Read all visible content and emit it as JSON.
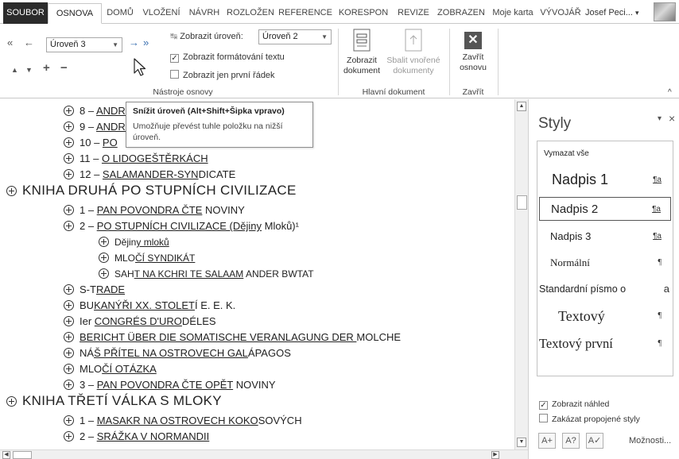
{
  "tabs": [
    {
      "label": "SOUBOR",
      "state": "file"
    },
    {
      "label": "OSNOVA",
      "state": "active"
    },
    {
      "label": "DOMŮ",
      "state": ""
    },
    {
      "label": "VLOŽENÍ",
      "state": ""
    },
    {
      "label": "NÁVRH",
      "state": ""
    },
    {
      "label": "ROZLOŽEN",
      "state": ""
    },
    {
      "label": "REFERENCE",
      "state": ""
    },
    {
      "label": "KORESPON",
      "state": ""
    },
    {
      "label": "REVIZE",
      "state": ""
    },
    {
      "label": "ZOBRAZEN",
      "state": ""
    },
    {
      "label": "Moje karta",
      "state": ""
    },
    {
      "label": "VÝVOJÁŘ",
      "state": ""
    }
  ],
  "user": {
    "name": "Josef Peci...",
    "caret": "▾"
  },
  "ribbon": {
    "outline_tools": {
      "level_dropdown_value": "Úroveň 3",
      "show_level_label": "Zobrazit úroveň:",
      "show_level_value": "Úroveň 2",
      "show_formatting_label": "Zobrazit formátování textu",
      "show_formatting_checked": true,
      "first_line_label": "Zobrazit jen první řádek",
      "first_line_checked": false,
      "group_label": "Nástroje osnovy",
      "promote_to_top_glyph": "«",
      "promote_glyph": "←",
      "demote_glyph": "→",
      "demote_to_body_glyph": "»",
      "move_up_glyph": "▲",
      "move_down_glyph": "▼",
      "expand_glyph": "+",
      "collapse_glyph": "−"
    },
    "master_document": {
      "show_document_label_1": "Zobrazit",
      "show_document_label_2": "dokument",
      "collapse_subdocs_label_1": "Sbalit vnořené",
      "collapse_subdocs_label_2": "dokumenty",
      "group_label": "Hlavní dokument"
    },
    "close": {
      "button_label_1": "Zavřít",
      "button_label_2": "osnovu",
      "group_label": "Zavřít"
    },
    "collapse_ribbon_glyph": "^"
  },
  "tooltip": {
    "title": "Snížit úroveň (Alt+Shift+Šipka vpravo)",
    "body_line1": "Umožňuje převést tuhle položku na nižší",
    "body_line2": "úroveň."
  },
  "outline": {
    "items": [
      {
        "level": 2,
        "parts": [
          {
            "t": "8 – ",
            "u": false
          },
          {
            "t": "ANDREW SCHEUCHZERI",
            "u": true
          }
        ]
      },
      {
        "level": 2,
        "parts": [
          {
            "t": "9 – ",
            "u": false
          },
          {
            "t": "ANDREW SCHEUCHZERI",
            "u": true
          }
        ]
      },
      {
        "level": 2,
        "parts": [
          {
            "t": "10 – ",
            "u": false
          },
          {
            "t": "PO",
            "u": true
          }
        ]
      },
      {
        "level": 2,
        "parts": [
          {
            "t": "11 – ",
            "u": false
          },
          {
            "t": "O LIDOGEŠTĚRKÁCH",
            "u": true
          }
        ]
      },
      {
        "level": 2,
        "parts": [
          {
            "t": "12 – ",
            "u": false
          },
          {
            "t": "SALAMANDER-SYN",
            "u": true
          },
          {
            "t": "DICATE",
            "u": false
          }
        ]
      },
      {
        "level": 1,
        "parts": [
          {
            "t": "KNIHA DRUHÁ PO STUPNÍCH CIVILIZACE",
            "u": false
          }
        ]
      },
      {
        "level": 2,
        "parts": [
          {
            "t": "1 – ",
            "u": false
          },
          {
            "t": "PAN POVONDRA ČTE",
            "u": true
          },
          {
            "t": " NOVINY",
            "u": false
          }
        ]
      },
      {
        "level": 2,
        "parts": [
          {
            "t": "2 – ",
            "u": false
          },
          {
            "t": "PO STUPNÍCH CIVILIZACE (Dějiny",
            "u": true
          },
          {
            "t": " Mloků)¹",
            "u": false
          }
        ]
      },
      {
        "level": 3,
        "parts": [
          {
            "t": "Dějin",
            "u": false
          },
          {
            "t": "y mloků       ",
            "u": true
          }
        ]
      },
      {
        "level": 3,
        "parts": [
          {
            "t": "MLO",
            "u": false
          },
          {
            "t": "ČÍ SYNDIKÁT  ",
            "u": true
          }
        ]
      },
      {
        "level": 3,
        "parts": [
          {
            "t": "SAH",
            "u": false
          },
          {
            "t": "T NA KCHRI TE SALAAM",
            "u": true
          },
          {
            "t": " ANDER BWTAT",
            "u": false
          }
        ]
      },
      {
        "level": 2,
        "parts": [
          {
            "t": "S-T",
            "u": false
          },
          {
            "t": "RADE              ",
            "u": true
          }
        ]
      },
      {
        "level": 2,
        "parts": [
          {
            "t": "BU",
            "u": false
          },
          {
            "t": "KANÝŘI XX. STOLET",
            "u": true
          },
          {
            "t": "Í E. E. K.",
            "u": false
          }
        ]
      },
      {
        "level": 2,
        "parts": [
          {
            "t": "Ier ",
            "u": false
          },
          {
            "t": "CONGRÉS D'URO",
            "u": true
          },
          {
            "t": "DÉLES",
            "u": false
          }
        ]
      },
      {
        "level": 2,
        "parts": [
          {
            "t": "BERICHT ÜBER DIE SOMATISCHE VERANLAGUNG DER ",
            "u": true
          },
          {
            "t": "MOLCHE",
            "u": false
          }
        ]
      },
      {
        "level": 2,
        "parts": [
          {
            "t": "NÁ",
            "u": false
          },
          {
            "t": "Š PŘÍTEL NA OSTROVECH GAL",
            "u": true
          },
          {
            "t": "ÁPAGOS",
            "u": false
          }
        ]
      },
      {
        "level": 2,
        "parts": [
          {
            "t": "MLO",
            "u": false
          },
          {
            "t": "ČÍ OTÁZKA    ",
            "u": true
          }
        ]
      },
      {
        "level": 2,
        "parts": [
          {
            "t": "3 – ",
            "u": false
          },
          {
            "t": "PAN POVONDRA ČTE OPĚT",
            "u": true
          },
          {
            "t": " NOVINY",
            "u": false
          }
        ]
      },
      {
        "level": 1,
        "parts": [
          {
            "t": "KNIHA TŘETÍ VÁLKA S MLOKY",
            "u": false
          }
        ]
      },
      {
        "level": 2,
        "parts": [
          {
            "t": "1 – ",
            "u": false
          },
          {
            "t": "MASAKR NA OSTROVECH KOKO",
            "u": true
          },
          {
            "t": "SOVÝCH",
            "u": false
          }
        ]
      },
      {
        "level": 2,
        "parts": [
          {
            "t": "2 – ",
            "u": false
          },
          {
            "t": "SRÁŽKA V NORMANDII",
            "u": true
          }
        ]
      }
    ]
  },
  "styles_pane": {
    "title": "Styly",
    "menu_glyph": "▾",
    "close_glyph": "×",
    "items": [
      {
        "name": "Vymazat vše",
        "mark": "",
        "selected": false
      },
      {
        "name": "Nadpis 1",
        "mark": "¶a",
        "selected": false
      },
      {
        "name": "Nadpis 2",
        "mark": "¶a",
        "selected": true
      },
      {
        "name": "Nadpis 3",
        "mark": "¶a",
        "selected": false
      },
      {
        "name": "Normální",
        "mark": "¶",
        "selected": false
      },
      {
        "name": "Standardní písmo o",
        "mark": "a",
        "selected": false
      },
      {
        "name": "Textový",
        "mark": "¶",
        "selected": false
      },
      {
        "name": "Textový první",
        "mark": "¶",
        "selected": false
      }
    ],
    "show_preview_label": "Zobrazit náhled",
    "show_preview_checked": true,
    "disable_linked_label": "Zakázat propojené styly",
    "disable_linked_checked": false,
    "new_style_glyph": "A+",
    "inspector_glyph": "A?",
    "manage_glyph": "A✓",
    "options_label": "Možnosti..."
  }
}
